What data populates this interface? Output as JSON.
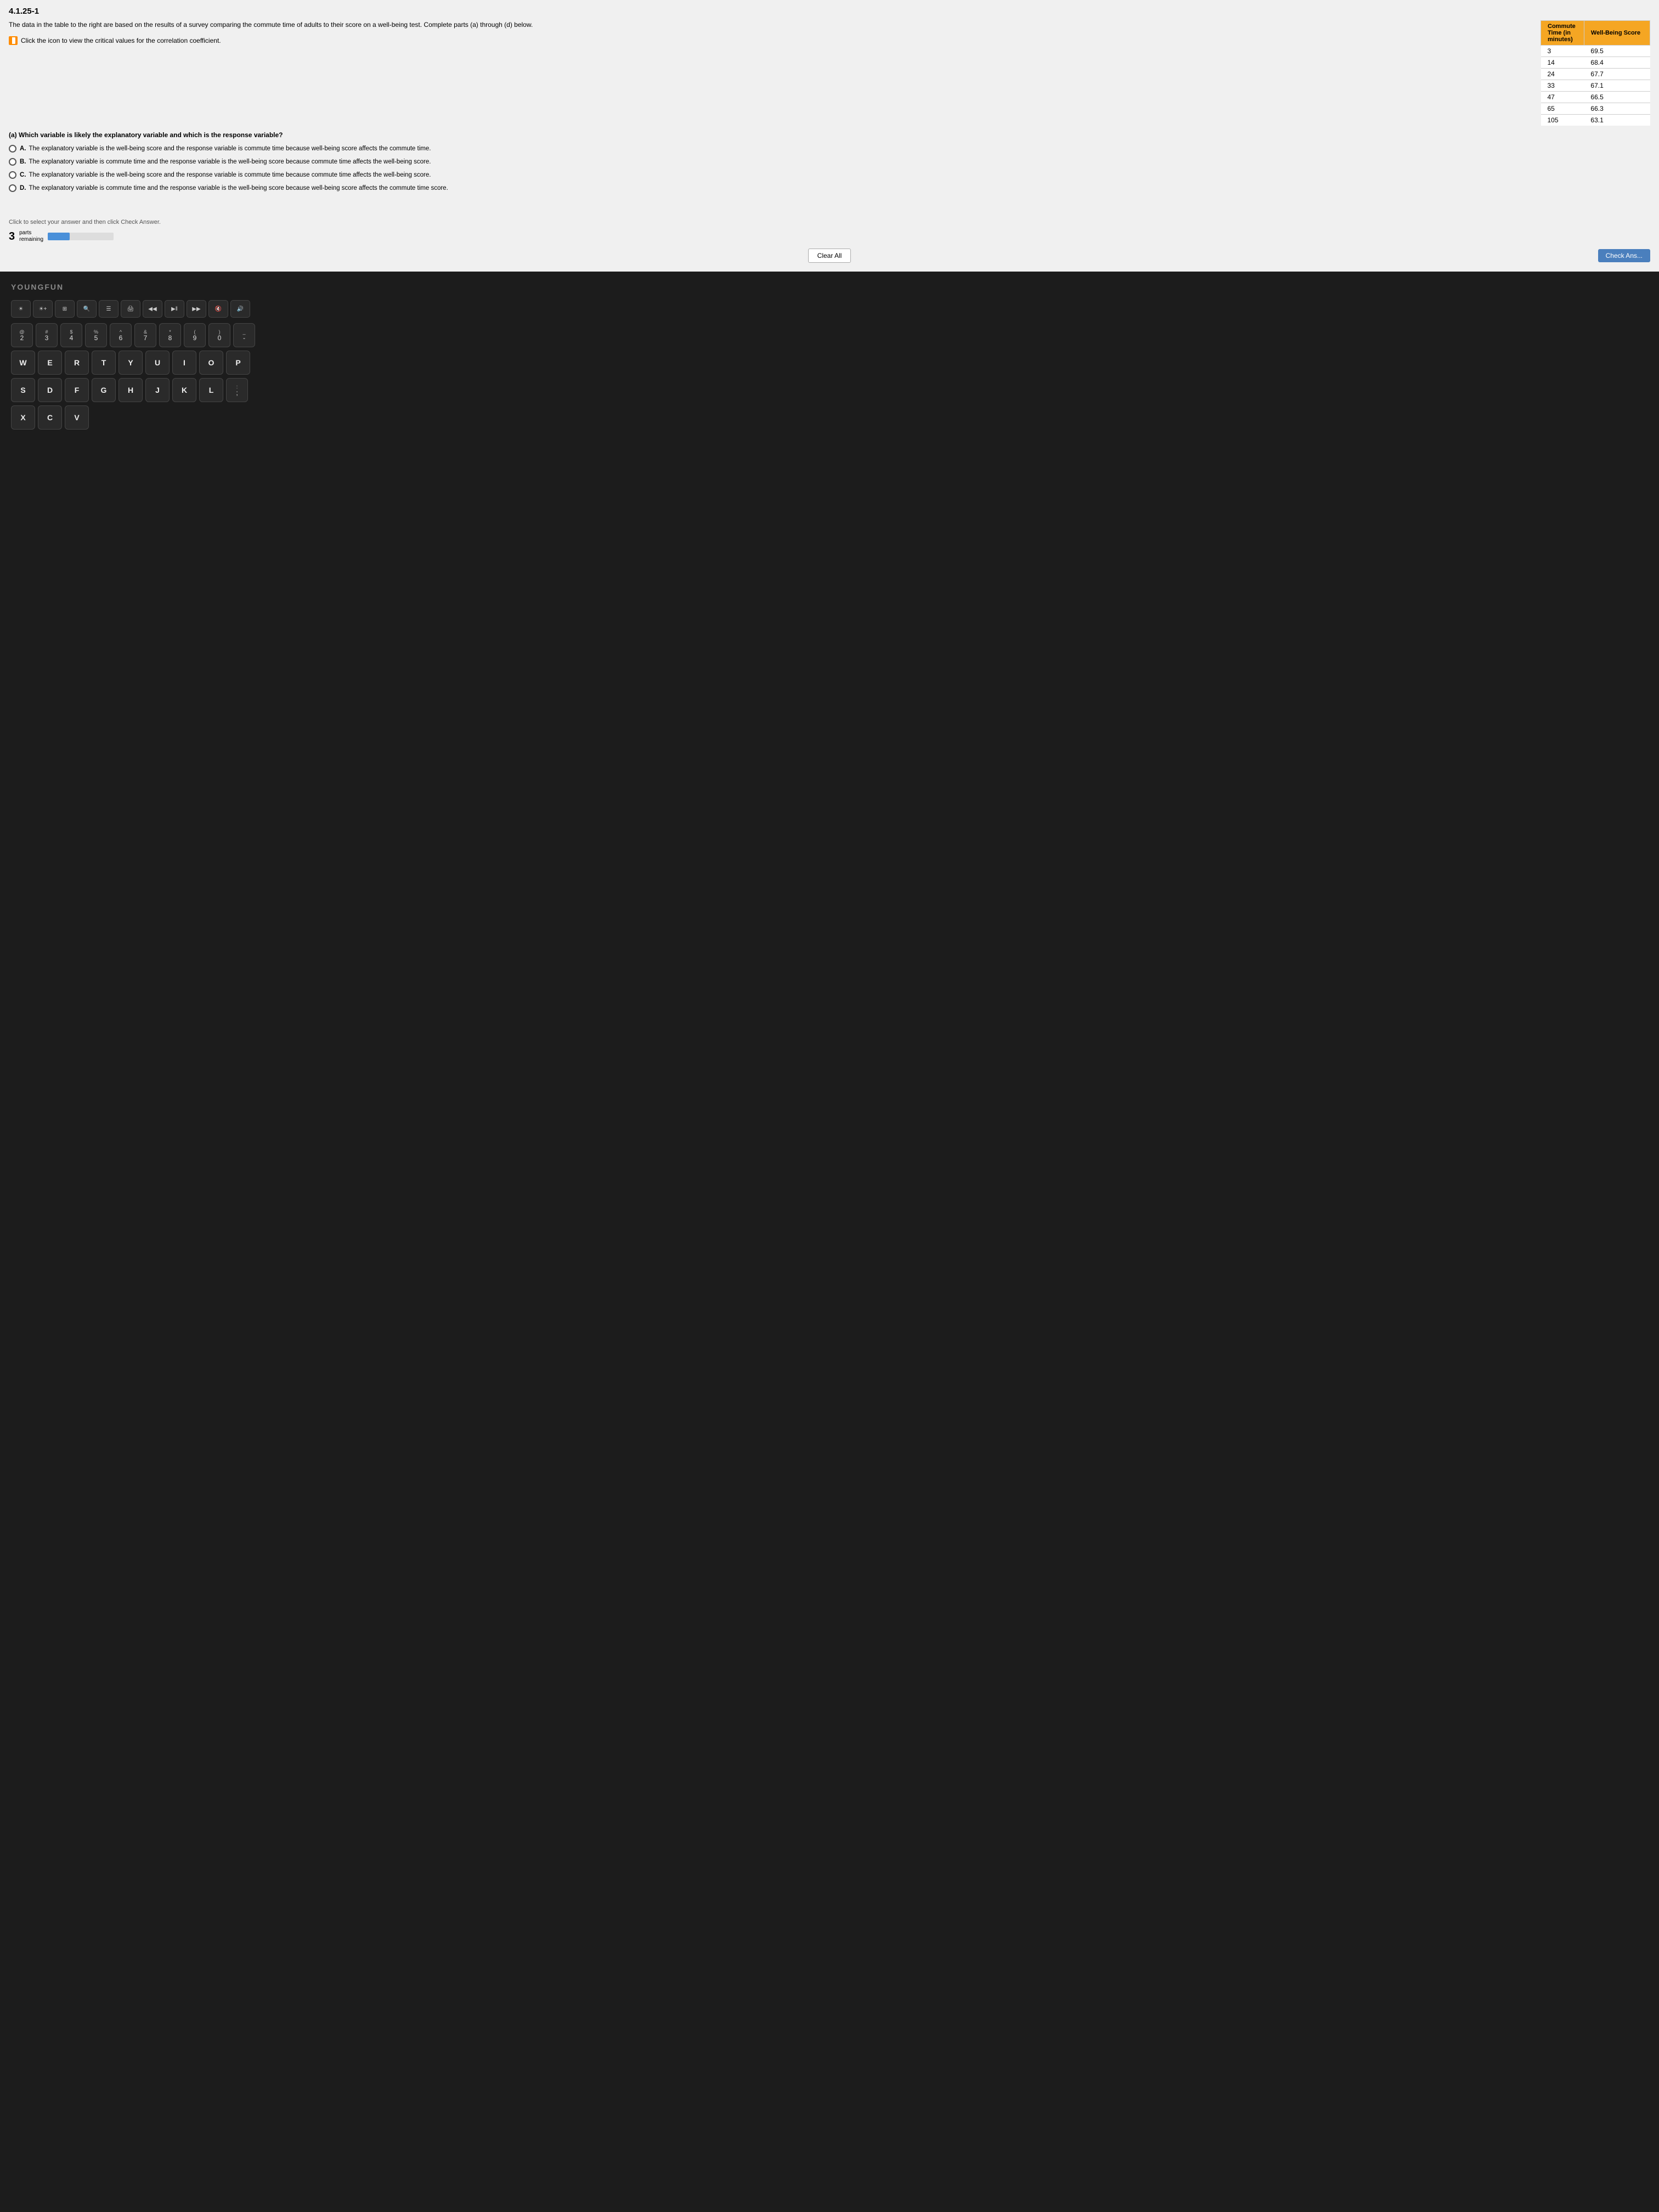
{
  "page": {
    "title": "4.1.25-1",
    "intro": "The data in the table to the right are based on the results of a survey comparing the commute time of adults to their score on a well-being test. Complete parts (a) through (d) below.",
    "icon_text": "Click the icon to view the critical values for the correlation coefficient.",
    "table": {
      "headers": [
        "Commute Time (in minutes)",
        "Well-Being Score"
      ],
      "rows": [
        {
          "commute": "3",
          "score": "69.5"
        },
        {
          "commute": "14",
          "score": "68.4"
        },
        {
          "commute": "24",
          "score": "67.7"
        },
        {
          "commute": "33",
          "score": "67.1"
        },
        {
          "commute": "47",
          "score": "66.5"
        },
        {
          "commute": "65",
          "score": "66.3"
        },
        {
          "commute": "105",
          "score": "63.1"
        }
      ]
    },
    "question": {
      "label": "(a) Which variable is likely the explanatory variable and which is the response variable?",
      "options": [
        {
          "id": "A",
          "text": "The explanatory variable is the well-being score and the response variable is commute time because well-being score affects the commute time."
        },
        {
          "id": "B",
          "text": "The explanatory variable is commute time and the response variable is the well-being score because commute time affects the well-being score."
        },
        {
          "id": "C",
          "text": "The explanatory variable is the well-being score and the response variable is commute time because commute time affects the well-being score."
        },
        {
          "id": "D",
          "text": "The explanatory variable is commute time and the response variable is the well-being score because well-being score affects the commute time score."
        }
      ]
    },
    "click_instruction": "Click to select your answer and then click Check Answer.",
    "parts_remaining": {
      "number": "3",
      "parts_label": "parts",
      "remaining_label": "remaining"
    },
    "buttons": {
      "clear_all": "Clear All",
      "check_answer": "Check Ans..."
    }
  },
  "keyboard": {
    "brand": "YOUNGFUN",
    "rows": [
      {
        "keys": [
          {
            "top": "☀",
            "bottom": "",
            "type": "fn-sym"
          },
          {
            "top": "☀",
            "bottom": "",
            "type": "fn-sym"
          },
          {
            "top": "⊞",
            "bottom": "",
            "type": "fn-sym"
          },
          {
            "top": "🔍",
            "bottom": "",
            "type": "fn-sym"
          },
          {
            "top": "≡",
            "bottom": "",
            "type": "fn-sym"
          },
          {
            "top": "🖨",
            "bottom": "",
            "type": "fn-sym"
          },
          {
            "top": "◀◀",
            "bottom": "",
            "type": "fn-sym"
          },
          {
            "top": "▶‖",
            "bottom": "",
            "type": "fn-sym"
          },
          {
            "top": "▶▶",
            "bottom": "",
            "type": "fn-sym"
          },
          {
            "top": "🔇",
            "bottom": "",
            "type": "fn-sym"
          },
          {
            "top": "🔊",
            "bottom": "",
            "type": "fn-sym"
          }
        ]
      },
      {
        "keys": [
          {
            "top": "@",
            "bottom": "2",
            "type": "num"
          },
          {
            "top": "#",
            "bottom": "3",
            "type": "num"
          },
          {
            "top": "$",
            "bottom": "4",
            "type": "num"
          },
          {
            "top": "%",
            "bottom": "5",
            "type": "num"
          },
          {
            "top": "^",
            "bottom": "6",
            "type": "num"
          },
          {
            "top": "&",
            "bottom": "7",
            "type": "num"
          },
          {
            "top": "*",
            "bottom": "8",
            "type": "num"
          },
          {
            "top": "(",
            "bottom": "9",
            "type": "num"
          },
          {
            "top": ")",
            "bottom": "0",
            "type": "num"
          },
          {
            "top": "_",
            "bottom": "-",
            "type": "num"
          }
        ]
      },
      {
        "keys": [
          {
            "top": "",
            "bottom": "W",
            "type": "letter"
          },
          {
            "top": "",
            "bottom": "E",
            "type": "letter"
          },
          {
            "top": "",
            "bottom": "R",
            "type": "letter"
          },
          {
            "top": "",
            "bottom": "T",
            "type": "letter"
          },
          {
            "top": "",
            "bottom": "Y",
            "type": "letter"
          },
          {
            "top": "",
            "bottom": "U",
            "type": "letter"
          },
          {
            "top": "",
            "bottom": "I",
            "type": "letter"
          },
          {
            "top": "",
            "bottom": "O",
            "type": "letter"
          },
          {
            "top": "",
            "bottom": "P",
            "type": "letter"
          }
        ]
      },
      {
        "keys": [
          {
            "top": "",
            "bottom": "S",
            "type": "letter"
          },
          {
            "top": "",
            "bottom": "D",
            "type": "letter"
          },
          {
            "top": "",
            "bottom": "F",
            "type": "letter"
          },
          {
            "top": "",
            "bottom": "G",
            "type": "letter"
          },
          {
            "top": "",
            "bottom": "H",
            "type": "letter"
          },
          {
            "top": "",
            "bottom": "J",
            "type": "letter"
          },
          {
            "top": "",
            "bottom": "K",
            "type": "letter"
          },
          {
            "top": "",
            "bottom": "L",
            "type": "letter"
          },
          {
            "top": ":",
            "bottom": ";",
            "type": "sym"
          }
        ]
      },
      {
        "keys": [
          {
            "top": "",
            "bottom": "X",
            "type": "letter"
          },
          {
            "top": "",
            "bottom": "C",
            "type": "letter"
          },
          {
            "top": "",
            "bottom": "V",
            "type": "letter"
          }
        ]
      }
    ]
  }
}
